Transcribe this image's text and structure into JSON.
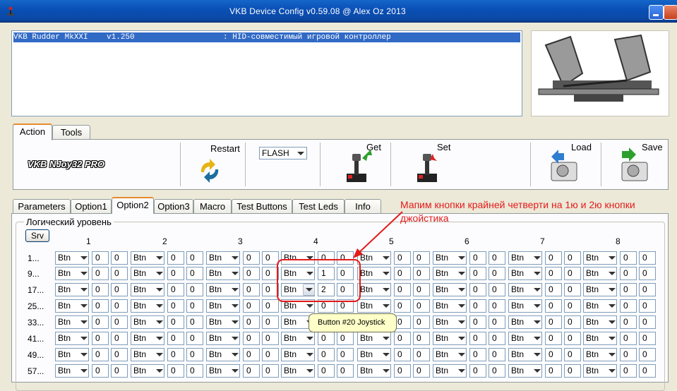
{
  "window": {
    "title": "VKB Device Config v0.59.08 @ Alex Oz 2013"
  },
  "device_list": {
    "rows": [
      "VKB Rudder MkXXI    v1.250                   : HID-совместимый игровой контроллер"
    ]
  },
  "top_tabs": [
    "Action",
    "Tools"
  ],
  "toolbar": {
    "device_name": "VKB NJoy32 PRO",
    "restart_label": "Restart",
    "flash_mode": "FLASH",
    "get_label": "Get",
    "set_label": "Set",
    "load_label": "Load",
    "save_label": "Save"
  },
  "option_tabs": [
    "Parameters",
    "Option1",
    "Option2",
    "Option3",
    "Macro",
    "Test Buttons",
    "Test Leds",
    "Info"
  ],
  "logic": {
    "group_title": "Логический уровень",
    "srv_label": "Srv",
    "columns": [
      "1",
      "2",
      "3",
      "4",
      "5",
      "6",
      "7",
      "8"
    ],
    "rows": [
      {
        "label": "1...",
        "cells": [
          [
            "Btn",
            "0",
            "0"
          ],
          [
            "Btn",
            "0",
            "0"
          ],
          [
            "Btn",
            "0",
            "0"
          ],
          [
            "Btn",
            "0",
            "0"
          ],
          [
            "Btn",
            "0",
            "0"
          ],
          [
            "Btn",
            "0",
            "0"
          ],
          [
            "Btn",
            "0",
            "0"
          ],
          [
            "Btn",
            "0",
            "0"
          ]
        ]
      },
      {
        "label": "9...",
        "cells": [
          [
            "Btn",
            "0",
            "0"
          ],
          [
            "Btn",
            "0",
            "0"
          ],
          [
            "Btn",
            "0",
            "0"
          ],
          [
            "Btn",
            "1",
            "0"
          ],
          [
            "Btn",
            "0",
            "0"
          ],
          [
            "Btn",
            "0",
            "0"
          ],
          [
            "Btn",
            "0",
            "0"
          ],
          [
            "Btn",
            "0",
            "0"
          ]
        ]
      },
      {
        "label": "17...",
        "cells": [
          [
            "Btn",
            "0",
            "0"
          ],
          [
            "Btn",
            "0",
            "0"
          ],
          [
            "Btn",
            "0",
            "0"
          ],
          [
            "Btn",
            "2",
            "0"
          ],
          [
            "Btn",
            "0",
            "0"
          ],
          [
            "Btn",
            "0",
            "0"
          ],
          [
            "Btn",
            "0",
            "0"
          ],
          [
            "Btn",
            "0",
            "0"
          ]
        ]
      },
      {
        "label": "25...",
        "cells": [
          [
            "Btn",
            "0",
            "0"
          ],
          [
            "Btn",
            "0",
            "0"
          ],
          [
            "Btn",
            "0",
            "0"
          ],
          [
            "Btn",
            "0",
            "0"
          ],
          [
            "Btn",
            "0",
            "0"
          ],
          [
            "Btn",
            "0",
            "0"
          ],
          [
            "Btn",
            "0",
            "0"
          ],
          [
            "Btn",
            "0",
            "0"
          ]
        ]
      },
      {
        "label": "33...",
        "cells": [
          [
            "Btn",
            "0",
            "0"
          ],
          [
            "Btn",
            "0",
            "0"
          ],
          [
            "Btn",
            "0",
            "0"
          ],
          [
            "Btn",
            "0",
            "0"
          ],
          [
            "Btn",
            "0",
            "0"
          ],
          [
            "Btn",
            "0",
            "0"
          ],
          [
            "Btn",
            "0",
            "0"
          ],
          [
            "Btn",
            "0",
            "0"
          ]
        ]
      },
      {
        "label": "41...",
        "cells": [
          [
            "Btn",
            "0",
            "0"
          ],
          [
            "Btn",
            "0",
            "0"
          ],
          [
            "Btn",
            "0",
            "0"
          ],
          [
            "Btn",
            "0",
            "0"
          ],
          [
            "Btn",
            "0",
            "0"
          ],
          [
            "Btn",
            "0",
            "0"
          ],
          [
            "Btn",
            "0",
            "0"
          ],
          [
            "Btn",
            "0",
            "0"
          ]
        ]
      },
      {
        "label": "49...",
        "cells": [
          [
            "Btn",
            "0",
            "0"
          ],
          [
            "Btn",
            "0",
            "0"
          ],
          [
            "Btn",
            "0",
            "0"
          ],
          [
            "Btn",
            "0",
            "0"
          ],
          [
            "Btn",
            "0",
            "0"
          ],
          [
            "Btn",
            "0",
            "0"
          ],
          [
            "Btn",
            "0",
            "0"
          ],
          [
            "Btn",
            "0",
            "0"
          ]
        ]
      },
      {
        "label": "57...",
        "cells": [
          [
            "Btn",
            "0",
            "0"
          ],
          [
            "Btn",
            "0",
            "0"
          ],
          [
            "Btn",
            "0",
            "0"
          ],
          [
            "Btn",
            "0",
            "0"
          ],
          [
            "Btn",
            "0",
            "0"
          ],
          [
            "Btn",
            "0",
            "0"
          ],
          [
            "Btn",
            "0",
            "0"
          ],
          [
            "Btn",
            "0",
            "0"
          ]
        ]
      }
    ]
  },
  "annotation": {
    "text": "Мапим кнопки крайней четверти на 1ю и 2ю кнопки джойстика",
    "color": "#e31b1b"
  },
  "tooltip": {
    "text": "Button #20  Joystick"
  }
}
